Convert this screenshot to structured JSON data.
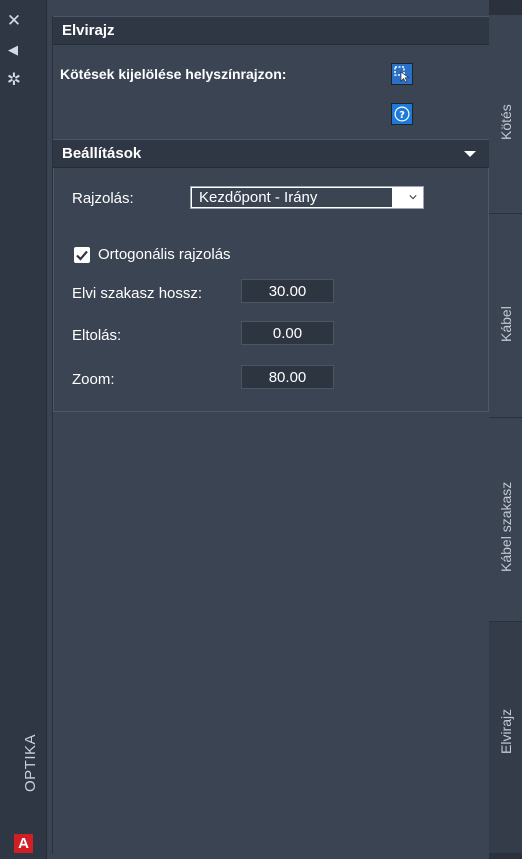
{
  "strip": {
    "title": "OPTIKA",
    "icons": [
      "close-icon",
      "pin-icon",
      "gear-icon",
      "autocad-logo"
    ],
    "close_glyph": "✕",
    "pin_glyph": "◀",
    "gear_glyph": "✲",
    "logo_letter": "A"
  },
  "section1": {
    "title": "Elvirajz",
    "row_label": "Kötések kijelölése helyszínrajzon:"
  },
  "section2": {
    "title": "Beállítások",
    "rajzolas_label": "Rajzolás:",
    "rajzolas_value": "Kezdőpont - Irány",
    "checkbox_label": "Ortogonális rajzolás",
    "checkbox_checked": true,
    "fields": [
      {
        "label": "Elvi szakasz hossz:",
        "value": "30.00"
      },
      {
        "label": "Eltolás:",
        "value": "0.00"
      },
      {
        "label": "Zoom:",
        "value": "80.00"
      }
    ]
  },
  "tabs": [
    "Kötés",
    "Kábel",
    "Kábel szakasz",
    "Elvirajz"
  ],
  "active_tab": "Elvirajz",
  "colors": {
    "panel_bg": "#3b4453",
    "header_bg": "#2f3744",
    "accent_button": "#2c6fc6"
  }
}
